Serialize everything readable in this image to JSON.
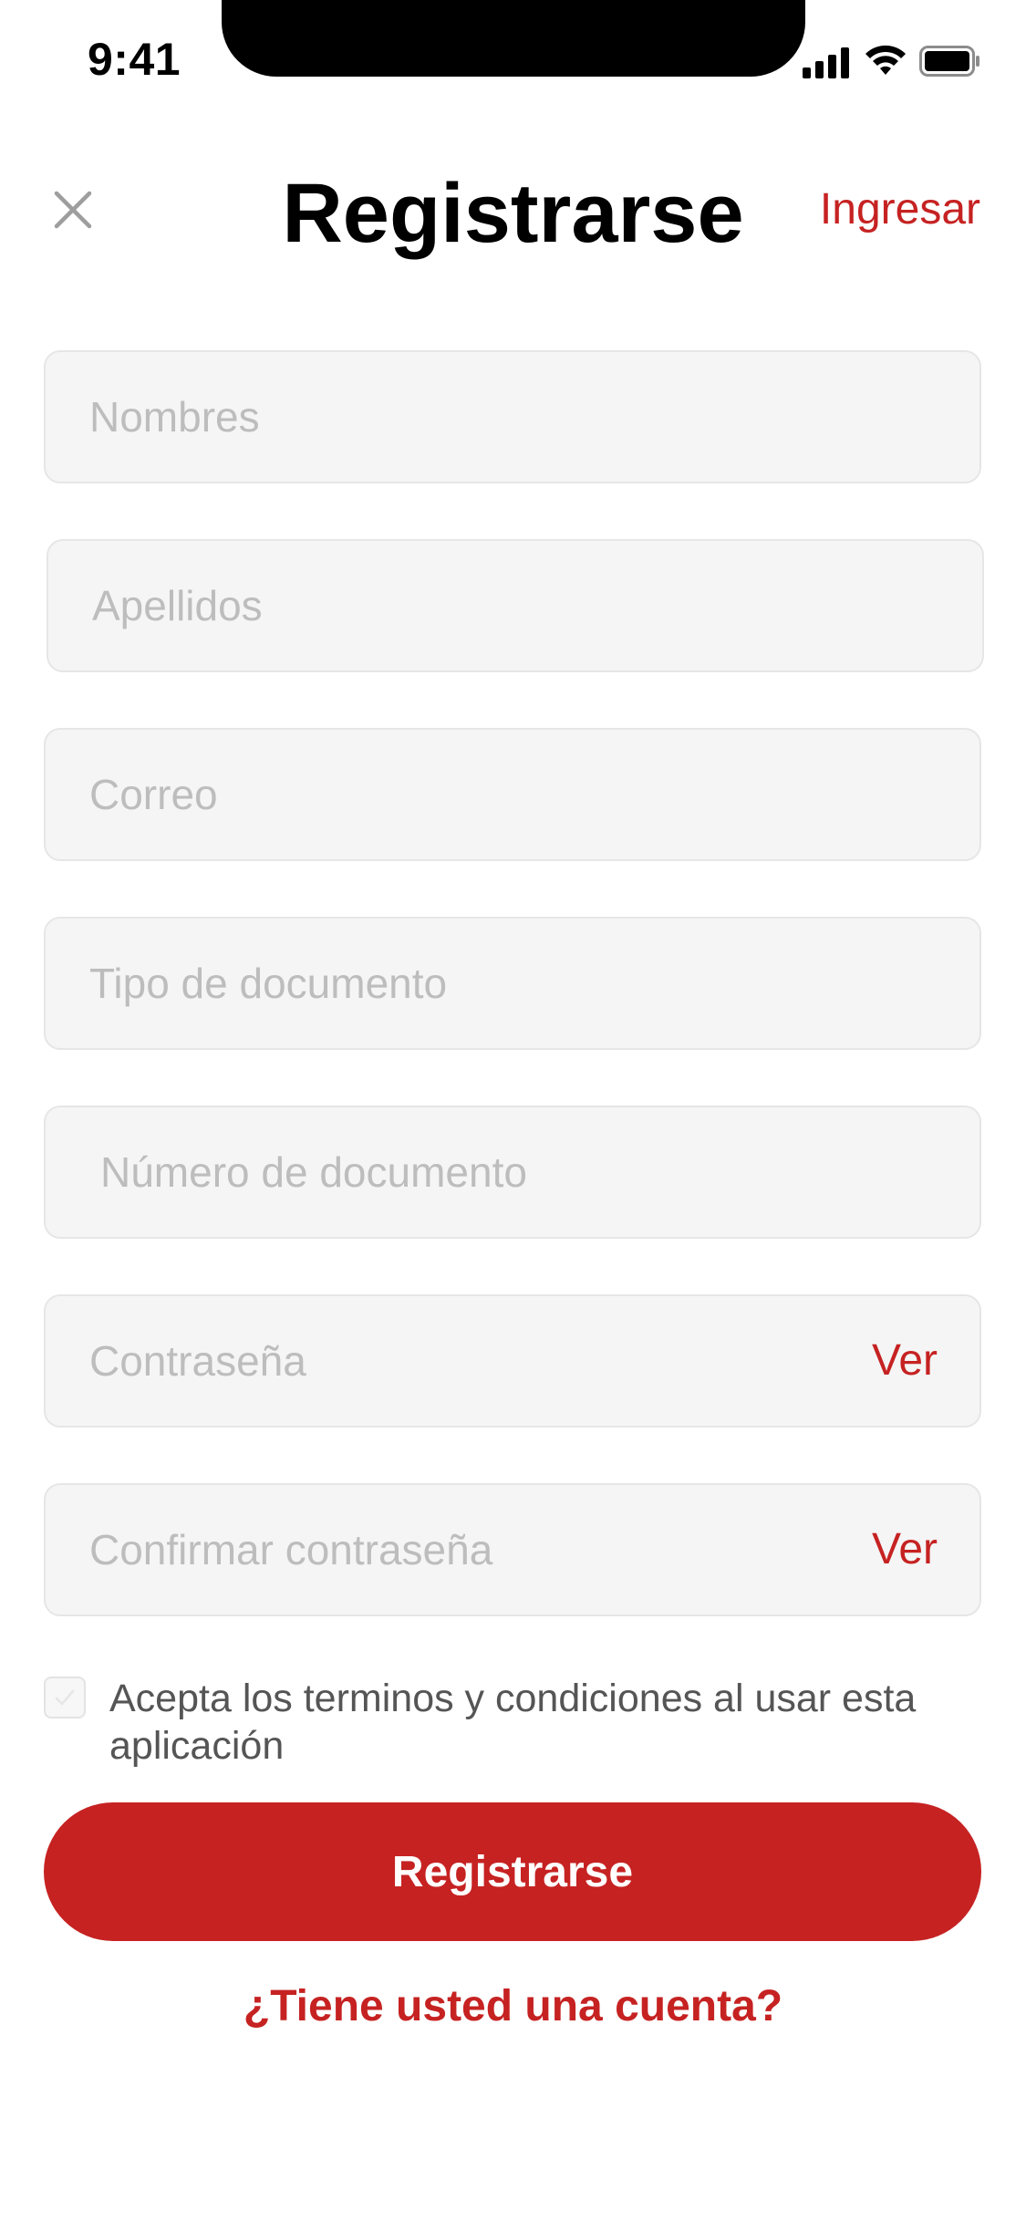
{
  "status_bar": {
    "time": "9:41",
    "icons": [
      "signal-icon",
      "wifi-icon",
      "battery-icon"
    ]
  },
  "header": {
    "title": "Registrarse",
    "login_link": "Ingresar",
    "close_icon": "close-icon"
  },
  "form": {
    "fields": [
      {
        "placeholder": "Nombres",
        "value": ""
      },
      {
        "placeholder": "Apellidos",
        "value": ""
      },
      {
        "placeholder": "Correo",
        "value": ""
      },
      {
        "placeholder": "Tipo de documento",
        "value": ""
      },
      {
        "placeholder": "Número de documento",
        "value": ""
      },
      {
        "placeholder": "Contraseña",
        "value": "",
        "toggle_label": "Ver"
      },
      {
        "placeholder": "Confirmar contraseña",
        "value": "",
        "toggle_label": "Ver"
      }
    ],
    "terms_text": "Acepta los terminos y condiciones al usar esta aplicación",
    "terms_checked": false,
    "submit_label": "Registrarse",
    "account_link": "¿Tiene usted una cuenta?"
  },
  "colors": {
    "accent": "#c62222",
    "field_bg": "#f5f5f5",
    "placeholder": "#bdbdbd"
  }
}
